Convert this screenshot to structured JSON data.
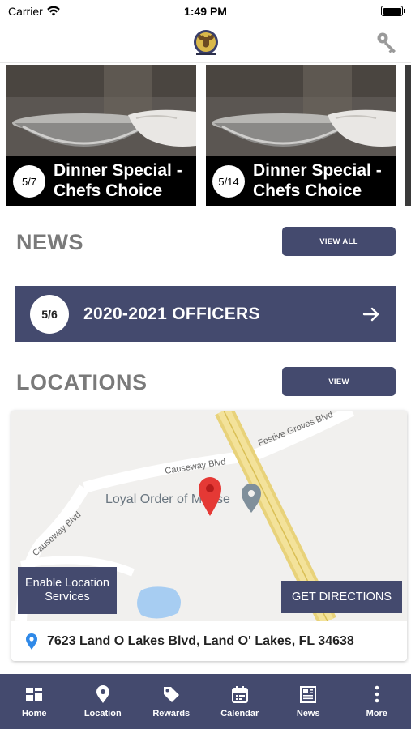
{
  "status_bar": {
    "carrier": "Carrier",
    "time": "1:49 PM"
  },
  "header": {
    "logo_icon": "moose-lodge-logo",
    "key_icon": "key-icon"
  },
  "specials": [
    {
      "date": "5/7",
      "title": "Dinner Special - Chefs Choice"
    },
    {
      "date": "5/14",
      "title": "Dinner Special - Chefs Choice"
    }
  ],
  "news": {
    "heading": "NEWS",
    "view_all_label": "VIEW ALL",
    "item": {
      "date": "5/6",
      "title": "2020-2021 OFFICERS"
    }
  },
  "locations": {
    "heading": "LOCATIONS",
    "view_label": "VIEW",
    "map": {
      "place_label": "Loyal Order of Moose",
      "roads": [
        "Causeway Blvd",
        "Festive Groves Blvd",
        "Causeway Blvd"
      ],
      "enable_location_label": "Enable Location Services",
      "directions_label": "GET DIRECTIONS"
    },
    "address": "7623 Land O Lakes Blvd, Land O' Lakes, FL 34638"
  },
  "tabs": [
    {
      "label": "Home",
      "icon": "home-grid-icon"
    },
    {
      "label": "Location",
      "icon": "location-pin-icon"
    },
    {
      "label": "Rewards",
      "icon": "tag-icon"
    },
    {
      "label": "Calendar",
      "icon": "calendar-icon"
    },
    {
      "label": "News",
      "icon": "newspaper-icon"
    },
    {
      "label": "More",
      "icon": "more-dots-icon"
    }
  ],
  "colors": {
    "accent": "#444a6e",
    "heading_gray": "#7a7a7a",
    "map_pin": "#e53935"
  }
}
